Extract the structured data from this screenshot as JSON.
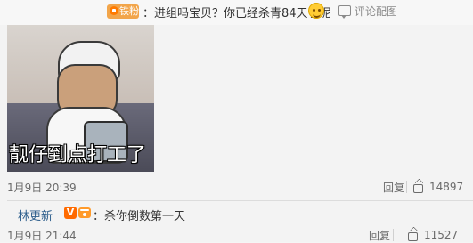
{
  "first_comment": {
    "author_hidden": "",
    "fan_badge": "铁粉",
    "text": "：进组吗宝贝？你已经杀青84天了呢",
    "emoji_name": "smile-emoji",
    "reply_link": "评论配图",
    "meme_caption": "靓仔到点打工了",
    "timestamp": "1月9日 20:39",
    "reply_label": "回复",
    "like_count": "14897"
  },
  "second_comment": {
    "author": "林更新",
    "v_badge": "V",
    "text": "：杀你倒数第一天",
    "timestamp": "1月9日 21:44",
    "reply_label": "回复",
    "like_count": "11527"
  },
  "icons": {
    "reply_icon": "comment-image-icon",
    "like_icon": "thumbs-up-icon"
  }
}
